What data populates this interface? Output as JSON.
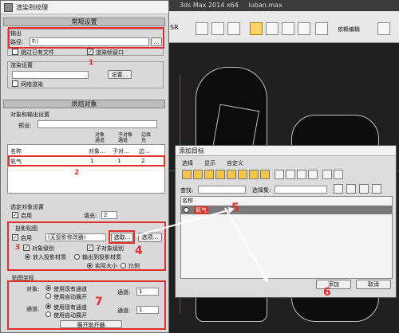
{
  "app": {
    "title": "3ds Max  2014 x64",
    "file": "luban.max",
    "srlabel": "SR",
    "toolbar_label": "依赖编辑"
  },
  "dialog": {
    "title": "渲染到纹理",
    "rollouts": {
      "general": "常规设置",
      "objects": "烘焙对象",
      "output": "输出"
    },
    "output_group": "输出",
    "path_label": "路径:",
    "path_value": "F:\\",
    "browse": "...",
    "skip_existing": "跳过已有文件",
    "render_frame": "渲染帧窗口",
    "render_settings": "渲染设置",
    "settings_btn": "设置...",
    "net_render": "网络渲染",
    "objects_and_output": "对象和输出设置",
    "preset_label": "预设:",
    "cols": {
      "name": "名称",
      "obj_channel": "对象...",
      "sub_channel": "子对...",
      "edge": "边..."
    },
    "col_heads": {
      "obj": "对象通道",
      "sub": "子对象通道",
      "edge": "边填充"
    },
    "row": {
      "name": "氧气",
      "obj": "1",
      "sub": "1",
      "edge": "2"
    },
    "selected_settings": "选定对象设置",
    "enabled": "启用",
    "fill": "填充:",
    "fill_value": "2",
    "projection": "投影贴图",
    "proj_enabled": "启用",
    "proj_select": "(无投影修改器)",
    "pick": "选取...",
    "options": "选项...",
    "obj_level": "对象级别",
    "sub_level": "子对象级别",
    "put_projection": "放入投影材质",
    "put_output": "输出到投影材质",
    "actual_size": "实际大小",
    "ratio": "比例",
    "mapping_coords": "贴图坐标",
    "object_label": "对象:",
    "use_existing": "使用现有通道",
    "use_auto": "使用自动展开",
    "channel_label": "通道:",
    "channel_value": "1",
    "sub_label": "通道:",
    "unwrap": "展开助开器"
  },
  "add_target": {
    "title": "添加目标",
    "menu": [
      "选择",
      "显示",
      "自定义"
    ],
    "find_label": "查找:",
    "select_set": "选择集:",
    "col_name": "名称",
    "item": "氧气",
    "add": "添加",
    "cancel": "取消"
  },
  "annotations": [
    "1",
    "2",
    "3",
    "4",
    "5",
    "6",
    "7"
  ]
}
